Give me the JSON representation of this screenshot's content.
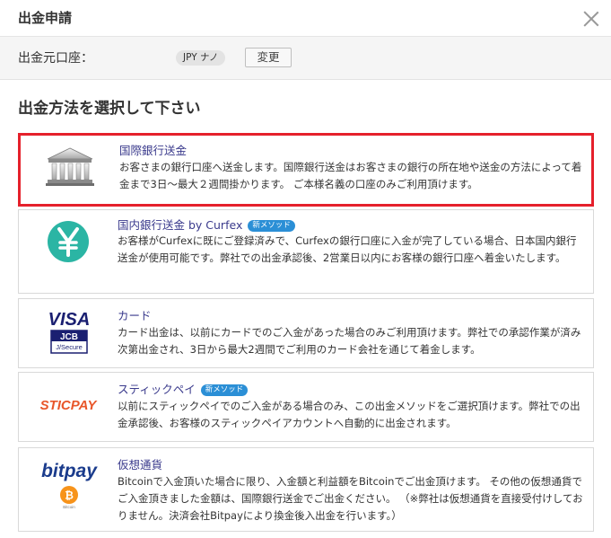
{
  "modal": {
    "title": "出金申請"
  },
  "source": {
    "label": "出金元口座：",
    "account": "JPY ナノ",
    "change_label": "変更"
  },
  "section_title": "出金方法を選択して下さい",
  "methods": [
    {
      "name": "国際銀行送金",
      "desc": "お客さまの銀行口座へ送金します。国際銀行送金はお客さまの銀行の所在地や送金の方法によって着金まで3日～最大２週間掛かります。 ご本様名義の口座のみご利用頂けます。",
      "logo": "bank-icon"
    },
    {
      "name": "国内銀行送金 by Curfex",
      "badge": "新メソッド",
      "desc": "お客様がCurfexに既にご登録済みで、Curfexの銀行口座に入金が完了している場合、日本国内銀行送金が使用可能です。弊社での出金承認後、2営業日以内にお客様の銀行口座へ着金いたします。",
      "logo": "yen-icon"
    },
    {
      "name": "カード",
      "desc": "カード出金は、以前にカードでのご入金があった場合のみご利用頂けます。弊社での承認作業が済み次第出金され、3日から最大2週間でご利用のカード会社を通じて着金します。",
      "logo": "card-icon",
      "logo_text": {
        "visa": "VISA",
        "jcb": "JCB",
        "secure": "J/Secure"
      }
    },
    {
      "name": "スティックペイ",
      "badge": "新メソッド",
      "desc": "以前にスティックペイでのご入金がある場合のみ、この出金メソッドをご選択頂けます。弊社での出金承認後、お客様のスティックペイアカウントへ自動的に出金されます。",
      "logo": "sticpay-icon",
      "logo_text": "STICPAY"
    },
    {
      "name": "仮想通貨",
      "desc": "Bitcoinで入金頂いた場合に限り、入金額と利益額をBitcoinでご出金頂けます。 その他の仮想通貨でご入金頂きました金額は、国際銀行送金でご出金ください。 （※弊社は仮想通貨を直接受付けしておりません。決済会社Bitpayにより換金後入出金を行います。）",
      "logo": "bitpay-icon",
      "logo_text": {
        "brand": "bitpay",
        "coin": "Bitcoin"
      }
    }
  ],
  "colors": {
    "selected_border": "#e5202b",
    "badge": "#2b8fd6",
    "method_title": "#3a3a8c",
    "yen": "#2bb5a4",
    "visa": "#1a1f71",
    "sticpay": "#e8562a",
    "bitpay": "#1a3b8c",
    "bitcoin": "#f7931a"
  }
}
